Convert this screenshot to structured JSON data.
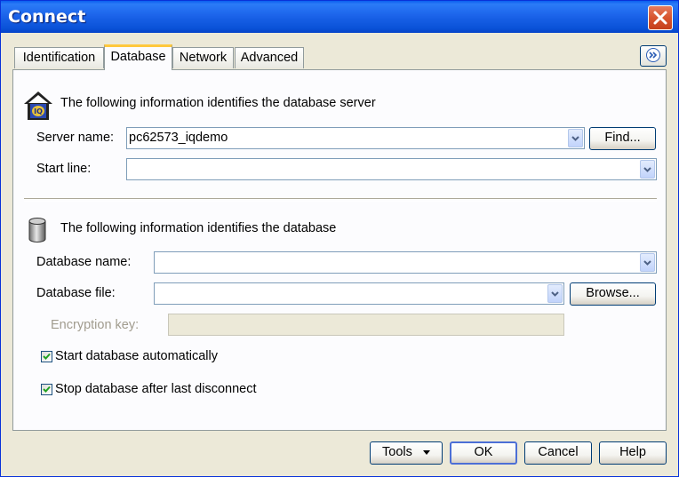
{
  "window": {
    "title": "Connect"
  },
  "tabs": [
    {
      "label": "Identification"
    },
    {
      "label": "Database"
    },
    {
      "label": "Network"
    },
    {
      "label": "Advanced"
    }
  ],
  "server_section": {
    "heading": "The following information identifies the database server",
    "server_name_label": "Server name:",
    "server_name_value": "pc62573_iqdemo",
    "find_button": "Find...",
    "start_line_label": "Start line:",
    "start_line_value": ""
  },
  "database_section": {
    "heading": "The following information identifies the database",
    "database_name_label": "Database name:",
    "database_name_value": "",
    "database_file_label": "Database file:",
    "database_file_value": "",
    "browse_button": "Browse...",
    "encryption_key_label": "Encryption key:",
    "encryption_key_value": "",
    "start_automatically_label": "Start database automatically",
    "start_automatically_checked": true,
    "stop_after_disconnect_label": "Stop database after last disconnect",
    "stop_after_disconnect_checked": true
  },
  "footer": {
    "tools_button": "Tools",
    "ok_button": "OK",
    "cancel_button": "Cancel",
    "help_button": "Help"
  }
}
